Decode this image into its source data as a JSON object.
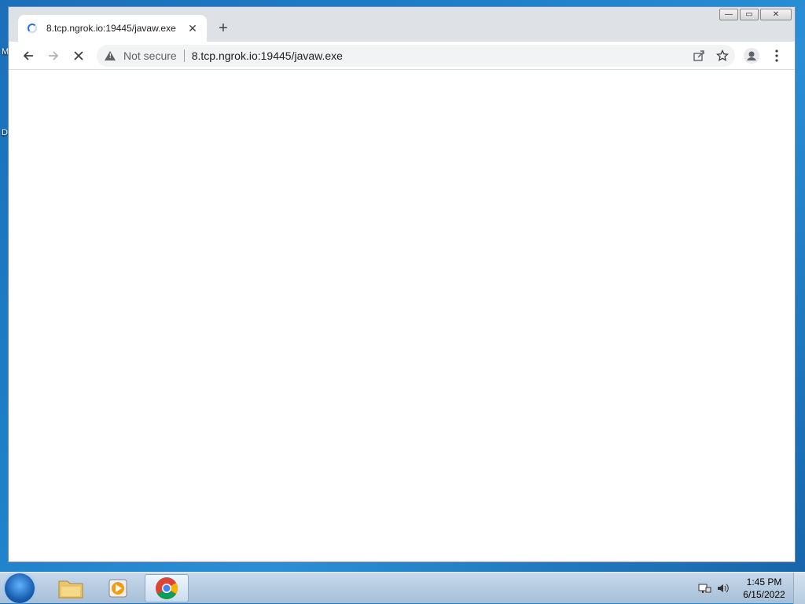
{
  "desktop": {
    "labels": [
      "M",
      "D"
    ]
  },
  "browser": {
    "tab": {
      "title": "8.tcp.ngrok.io:19445/javaw.exe",
      "loading": true
    },
    "new_tab_label": "+",
    "window_controls": {
      "minimize": "—",
      "maximize": "▭",
      "close": "✕"
    },
    "toolbar": {
      "back_icon": "arrow-left-icon",
      "forward_icon": "arrow-right-icon",
      "stop_icon": "close-icon",
      "security_label": "Not secure",
      "url": "8.tcp.ngrok.io:19445/javaw.exe"
    }
  },
  "taskbar": {
    "apps": [
      "windows-explorer",
      "media-player",
      "chrome"
    ],
    "active_app": "chrome",
    "clock": {
      "time": "1:45 PM",
      "date": "6/15/2022"
    }
  }
}
